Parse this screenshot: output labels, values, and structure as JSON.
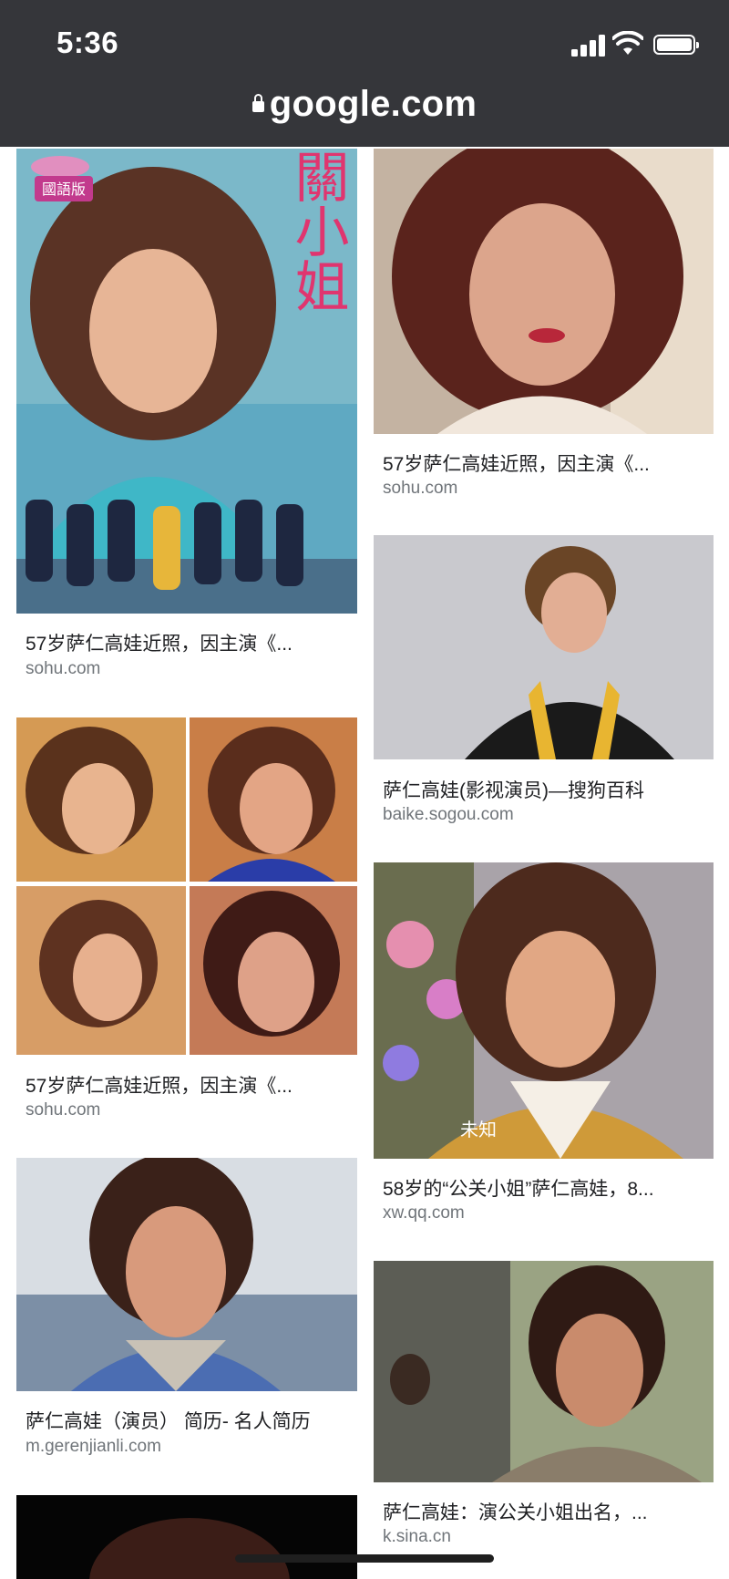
{
  "status_bar": {
    "time": "5:36"
  },
  "browser": {
    "url": "google.com"
  },
  "results": [
    {
      "title": "57岁萨仁高娃近照，因主演《...",
      "source": "sohu.com"
    },
    {
      "title": "57岁萨仁高娃近照，因主演《...",
      "source": "sohu.com"
    },
    {
      "title": "萨仁高娃(影视演员)—搜狗百科",
      "source": "baike.sogou.com"
    },
    {
      "title": "57岁萨仁高娃近照，因主演《...",
      "source": "sohu.com"
    },
    {
      "title": "58岁的“公关小姐”萨仁高娃，8...",
      "source": "xw.qq.com"
    },
    {
      "title": "萨仁高娃（演员） 简历- 名人简历",
      "source": "m.gerenjianli.com"
    },
    {
      "title": "萨仁高娃：演公关小姐出名，...",
      "source": "k.sina.cn"
    }
  ],
  "poster": {
    "vertical_title": "公關小姐",
    "badge": "國語版"
  },
  "image_overlays": {
    "unknown_label": "未知"
  },
  "colors": {
    "topbar": "#35363a",
    "title": "#202124",
    "source": "#70757a"
  }
}
